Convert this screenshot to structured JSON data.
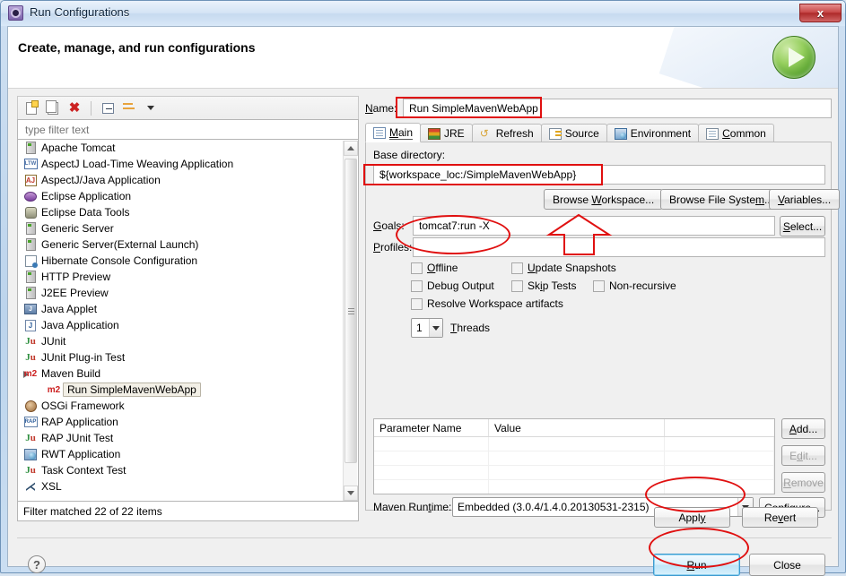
{
  "window": {
    "title": "Run Configurations",
    "title_icon": "gear-icon",
    "close_label": "x"
  },
  "header": {
    "title": "Create, manage, and run configurations",
    "run_icon": "green-run-play-icon"
  },
  "left_panel": {
    "toolbar": {
      "new_label": "new-configuration-icon",
      "duplicate_label": "duplicate-configuration-icon",
      "delete_label": "delete-configuration-icon",
      "collapse_label": "collapse-all-icon",
      "filter_label": "filter-icon",
      "menu_label": "view-menu-chevron-icon"
    },
    "filter": {
      "value": "",
      "placeholder": "type filter text"
    },
    "tree_items": [
      {
        "label": "Apache Tomcat",
        "icon": "server-icon",
        "level": 0
      },
      {
        "label": "AspectJ Load-Time Weaving Application",
        "icon": "ltw-icon",
        "level": 0
      },
      {
        "label": "AspectJ/Java Application",
        "icon": "aspectj-icon",
        "level": 0
      },
      {
        "label": "Eclipse Application",
        "icon": "eclipse-icon",
        "level": 0
      },
      {
        "label": "Eclipse Data Tools",
        "icon": "database-icon",
        "level": 0
      },
      {
        "label": "Generic Server",
        "icon": "server-icon",
        "level": 0
      },
      {
        "label": "Generic Server(External Launch)",
        "icon": "server-icon",
        "level": 0
      },
      {
        "label": "Hibernate Console Configuration",
        "icon": "hibernate-icon",
        "level": 0
      },
      {
        "label": "HTTP Preview",
        "icon": "server-icon",
        "level": 0
      },
      {
        "label": "J2EE Preview",
        "icon": "server-icon",
        "level": 0
      },
      {
        "label": "Java Applet",
        "icon": "java-applet-icon",
        "level": 0
      },
      {
        "label": "Java Application",
        "icon": "java-icon",
        "level": 0
      },
      {
        "label": "JUnit",
        "icon": "junit-icon",
        "level": 0
      },
      {
        "label": "JUnit Plug-in Test",
        "icon": "junit-plugin-icon",
        "level": 0
      },
      {
        "label": "Maven Build",
        "icon": "m2-icon",
        "level": 0,
        "expanded": true
      },
      {
        "label": "Run SimpleMavenWebApp",
        "icon": "m2-icon",
        "level": 1,
        "selected": true
      },
      {
        "label": "OSGi Framework",
        "icon": "osgi-icon",
        "level": 0
      },
      {
        "label": "RAP Application",
        "icon": "rap-icon",
        "level": 0
      },
      {
        "label": "RAP JUnit Test",
        "icon": "junit-icon",
        "level": 0
      },
      {
        "label": "RWT Application",
        "icon": "rwt-icon",
        "level": 0
      },
      {
        "label": "Task Context Test",
        "icon": "junit-icon",
        "level": 0
      },
      {
        "label": "XSL",
        "icon": "xsl-icon",
        "level": 0
      }
    ],
    "status_text": "Filter matched 22 of 22 items"
  },
  "right_panel": {
    "name_label": "Name:",
    "name_value": "Run  SimpleMavenWebApp",
    "tabs": [
      {
        "label": "Main",
        "icon": "main-tab-icon",
        "active": true,
        "accel": "M"
      },
      {
        "label": "JRE",
        "icon": "jre-tab-icon",
        "active": false
      },
      {
        "label": "Refresh",
        "icon": "refresh-tab-icon",
        "active": false
      },
      {
        "label": "Source",
        "icon": "source-tab-icon",
        "active": false
      },
      {
        "label": "Environment",
        "icon": "environment-tab-icon",
        "active": false
      },
      {
        "label": "Common",
        "icon": "common-tab-icon",
        "active": false,
        "accel": "C"
      }
    ],
    "main_tab": {
      "base_directory_label": "Base directory:",
      "base_directory_value": "${workspace_loc:/SimpleMavenWebApp}",
      "browse_workspace_label": "Browse Workspace...",
      "browse_file_system_label": "Browse File System...",
      "variables_label": "Variables...",
      "goals_label": "Goals:",
      "goals_value": "tomcat7:run -X",
      "select_label": "Select...",
      "profiles_label": "Profiles:",
      "profiles_value": "",
      "checkboxes": [
        {
          "label": "Offline",
          "checked": false
        },
        {
          "label": "Update Snapshots",
          "checked": false
        },
        {
          "label": "Debug Output",
          "checked": false
        },
        {
          "label": "Skip Tests",
          "checked": false
        },
        {
          "label": "Non-recursive",
          "checked": false
        },
        {
          "label": "Resolve Workspace artifacts",
          "checked": false
        }
      ],
      "threads_value": "1",
      "threads_label": "Threads",
      "table": {
        "columns": [
          "Parameter Name",
          "Value",
          ""
        ],
        "rows": []
      },
      "add_label": "Add...",
      "edit_label": "Edit...",
      "remove_label": "Remove",
      "maven_runtime_label": "Maven Runtime:",
      "maven_runtime_value": "Embedded (3.0.4/1.4.0.20130531-2315)",
      "configure_label": "Configure..."
    }
  },
  "footer": {
    "apply_label": "Apply",
    "revert_label": "Revert",
    "help_label": "?",
    "run_label": "Run",
    "close_label": "Close"
  },
  "annotations": {
    "accent_color": "#e01010",
    "name_field_highlight": "rectangle",
    "base_directory_highlight": "rectangle",
    "goals_highlight": "ellipse",
    "browse_workspace_pointer": "up-arrow",
    "apply_highlight": "ellipse",
    "run_highlight": "ellipse"
  }
}
